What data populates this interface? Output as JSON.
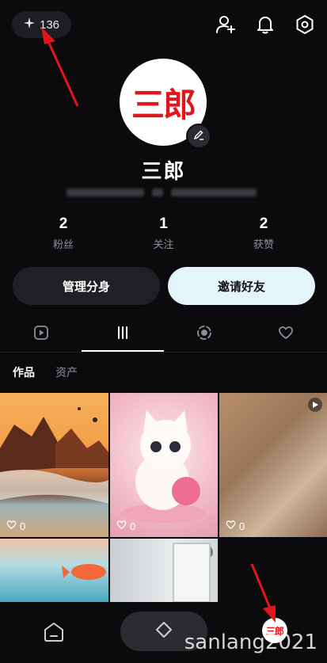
{
  "header": {
    "credits_value": "136",
    "icons": [
      "sparkle-icon",
      "add-friend-icon",
      "bell-icon",
      "settings-icon"
    ]
  },
  "profile": {
    "avatar_text": "三郎",
    "name": "三郎",
    "stats": [
      {
        "value": "2",
        "label": "粉丝"
      },
      {
        "value": "1",
        "label": "关注"
      },
      {
        "value": "2",
        "label": "获赞"
      }
    ]
  },
  "actions": {
    "manage_label": "管理分身",
    "invite_label": "邀请好友"
  },
  "tabs": [
    "play-video-icon",
    "grid-icon",
    "circle-target-icon",
    "heart-icon"
  ],
  "subtabs": {
    "works": "作品",
    "assets": "资产"
  },
  "posts": [
    {
      "likes": "0"
    },
    {
      "likes": "0"
    },
    {
      "likes": "0"
    }
  ],
  "bottom_nav": {
    "me_avatar_text": "三郎"
  },
  "watermark": "sanlang2021",
  "colors": {
    "background": "#0b0b0d",
    "button_dark": "#1f2024",
    "button_light": "#e3f4fb",
    "annotation_red": "#e0161b"
  }
}
